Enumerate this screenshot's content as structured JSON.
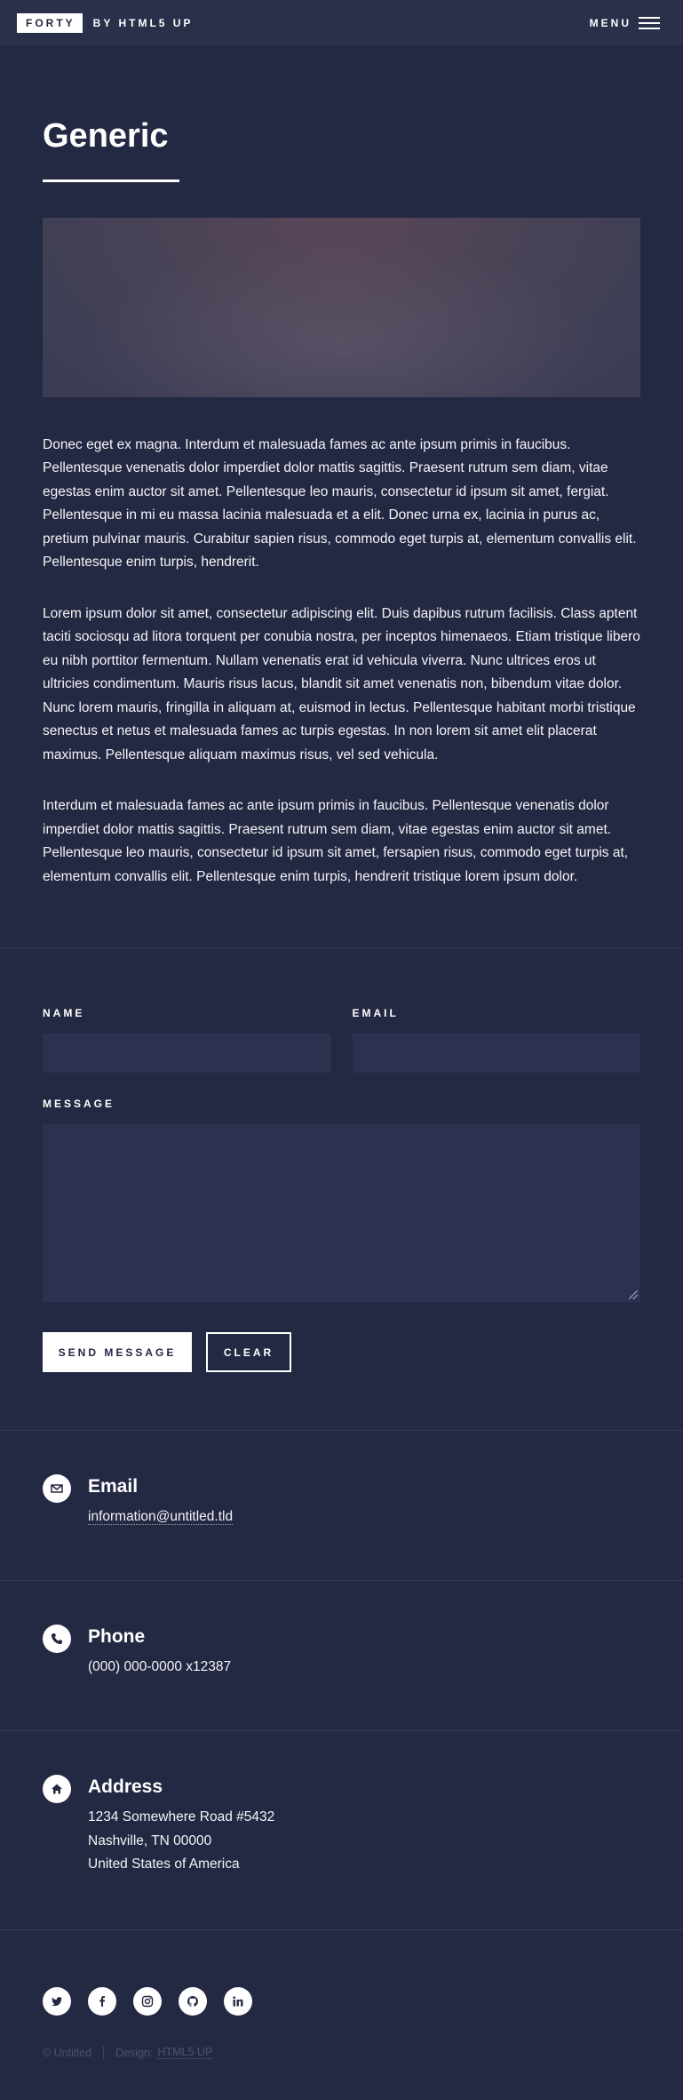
{
  "header": {
    "logo_box": "FORTY",
    "logo_rest": "BY HTML5 UP",
    "menu_label": "MENU"
  },
  "main": {
    "title": "Generic",
    "paragraphs": [
      "Donec eget ex magna. Interdum et malesuada fames ac ante ipsum primis in faucibus. Pellentesque venenatis dolor imperdiet dolor mattis sagittis. Praesent rutrum sem diam, vitae egestas enim auctor sit amet. Pellentesque leo mauris, consectetur id ipsum sit amet, fergiat. Pellentesque in mi eu massa lacinia malesuada et a elit. Donec urna ex, lacinia in purus ac, pretium pulvinar mauris. Curabitur sapien risus, commodo eget turpis at, elementum convallis elit. Pellentesque enim turpis, hendrerit.",
      "Lorem ipsum dolor sit amet, consectetur adipiscing elit. Duis dapibus rutrum facilisis. Class aptent taciti sociosqu ad litora torquent per conubia nostra, per inceptos himenaeos. Etiam tristique libero eu nibh porttitor fermentum. Nullam venenatis erat id vehicula viverra. Nunc ultrices eros ut ultricies condimentum. Mauris risus lacus, blandit sit amet venenatis non, bibendum vitae dolor. Nunc lorem mauris, fringilla in aliquam at, euismod in lectus. Pellentesque habitant morbi tristique senectus et netus et malesuada fames ac turpis egestas. In non lorem sit amet elit placerat maximus. Pellentesque aliquam maximus risus, vel sed vehicula.",
      "Interdum et malesuada fames ac ante ipsum primis in faucibus. Pellentesque venenatis dolor imperdiet dolor mattis sagittis. Praesent rutrum sem diam, vitae egestas enim auctor sit amet. Pellentesque leo mauris, consectetur id ipsum sit amet, fersapien risus, commodo eget turpis at, elementum convallis elit. Pellentesque enim turpis, hendrerit tristique lorem ipsum dolor."
    ]
  },
  "form": {
    "name_label": "NAME",
    "email_label": "EMAIL",
    "message_label": "MESSAGE",
    "name_value": "",
    "email_value": "",
    "message_value": "",
    "send_label": "SEND MESSAGE",
    "clear_label": "CLEAR"
  },
  "contact": {
    "email": {
      "title": "Email",
      "value": "information@untitled.tld",
      "icon": "envelope-icon"
    },
    "phone": {
      "title": "Phone",
      "value": "(000) 000-0000 x12387",
      "icon": "phone-icon"
    },
    "address": {
      "title": "Address",
      "line1": "1234 Somewhere Road #5432",
      "line2": "Nashville, TN 00000",
      "line3": "United States of America",
      "icon": "home-icon"
    }
  },
  "footer": {
    "social": [
      "twitter-icon",
      "facebook-icon",
      "instagram-icon",
      "github-icon",
      "linkedin-icon"
    ],
    "copyright": "© Untitled",
    "design_prefix": "Design:",
    "design_link": "HTML5 UP"
  },
  "colors": {
    "background": "#242943",
    "header_bg": "#2a2f4a",
    "input_bg": "#2c3150",
    "text": "#ffffff"
  }
}
